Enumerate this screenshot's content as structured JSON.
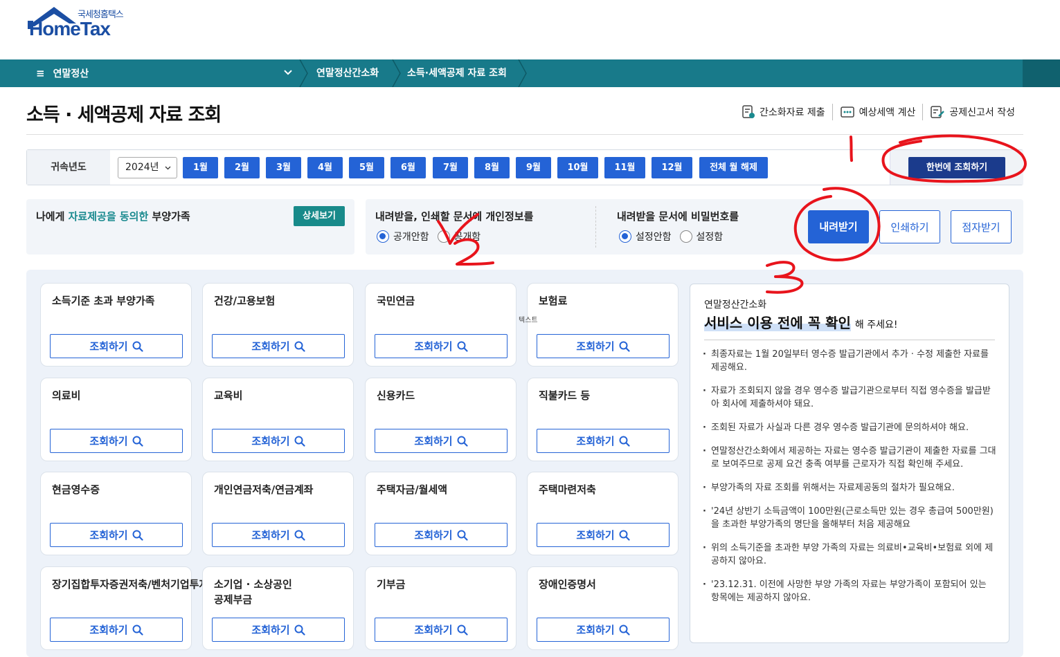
{
  "logo": {
    "sub": "국세청홈택스",
    "main": "HomeTax"
  },
  "nav": {
    "menu": "연말정산",
    "crumbs": [
      "연말정산간소화",
      "소득·세액공제 자료 조회"
    ]
  },
  "page_title": "소득 · 세액공제 자료 조회",
  "top_links": [
    {
      "label": "간소화자료 제출",
      "icon": "document-check-icon"
    },
    {
      "label": "예상세액 계산",
      "icon": "calculator-icon"
    },
    {
      "label": "공제신고서 작성",
      "icon": "form-edit-icon"
    }
  ],
  "year": {
    "label": "귀속년도",
    "selected": "2024년",
    "months": [
      "1월",
      "2월",
      "3월",
      "4월",
      "5월",
      "6월",
      "7월",
      "8월",
      "9월",
      "10월",
      "11월",
      "12월",
      "전체 월 해제"
    ],
    "search_all": "한번에 조회하기"
  },
  "consent": {
    "prefix": "나에게 ",
    "highlight": "자료제공을 동의한",
    "suffix": " 부양가족",
    "detail_button": "상세보기"
  },
  "options": {
    "privacy_title": "내려받을, 인쇄할 문서에 개인정보를",
    "privacy_opts": [
      "공개안함",
      "공개함"
    ],
    "password_title": "내려받을 문서에 비밀번호를",
    "password_opts": [
      "설정안함",
      "설정함"
    ],
    "download": "내려받기",
    "print": "인쇄하기",
    "braille": "점자받기"
  },
  "cards": [
    {
      "title": "소득기준 초과 부양가족"
    },
    {
      "title": "건강/고용보험"
    },
    {
      "title": "국민연금"
    },
    {
      "title": "보험료"
    },
    {
      "title": "의료비"
    },
    {
      "title": "교육비"
    },
    {
      "title": "신용카드"
    },
    {
      "title": "직불카드 등"
    },
    {
      "title": "현금영수증"
    },
    {
      "title": "개인연금저축/연금계좌"
    },
    {
      "title": "주택자금/월세액"
    },
    {
      "title": "주택마련저축"
    },
    {
      "title": "장기집합투자증권저축/벤처기업투자신탁"
    },
    {
      "title": "소기업 · 소상공인\n공제부금"
    },
    {
      "title": "기부금"
    },
    {
      "title": "장애인증명서"
    }
  ],
  "card_button": "조회하기",
  "text_tag": "텍스트",
  "notice": {
    "sub": "연말정산간소화",
    "head": "서비스 이용 전에 꼭 확인",
    "tail": "해 주세요!",
    "items": [
      "최종자료는 1월 20일부터 영수증 발급기관에서 추가 · 수정 제출한 자료를 제공해요.",
      "자료가 조회되지 않을 경우 영수증 발급기관으로부터 직접 영수증을 발급받아 회사에 제출하셔야 돼요.",
      "조회된 자료가 사실과 다른 경우 영수증 발급기관에 문의하셔야 해요.",
      "연말정산간소화에서 제공하는 자료는 영수증 발급기관이 제출한 자료를 그대로 보여주므로 공제 요건 충족 여부를 근로자가 직접 확인해 주세요.",
      "부양가족의 자료 조회를 위해서는 자료제공동의 절차가 필요해요.",
      "'24년 상반기 소득금액이 100만원(근로소득만 있는 경우 총급여 500만원)을 초과한 부양가족의 명단을 올해부터 처음 제공해요",
      "위의 소득기준을 초과한 부양 가족의 자료는 의료비•교육비•보험료 외에 제공하지 않아요.",
      "'23.12.31. 이전에 사망한 부양 가족의 자료는 부양가족이 포함되어 있는 항목에는 제공하지 않아요."
    ]
  },
  "colors": {
    "nav": "#187a8a",
    "primary": "#2463d6",
    "dark_button": "#1b3b8c",
    "annotation": "#e8141c"
  }
}
